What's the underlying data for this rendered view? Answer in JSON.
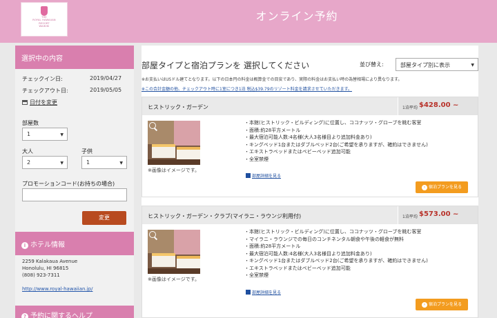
{
  "header": {
    "title": "オンライン予約",
    "logo": {
      "line1": "THE",
      "line2": "ROYAL HAWAIIAN",
      "line3": "RESORT",
      "line4": "WAIKIKI"
    }
  },
  "sidebar": {
    "selection_title": "選択中の内容",
    "checkin_label": "チェックイン日:",
    "checkin_value": "2019/04/27",
    "checkout_label": "チェックアウト日:",
    "checkout_value": "2019/05/05",
    "date_change": "日付を変更",
    "rooms_label": "部屋数",
    "rooms_value": "1",
    "adults_label": "大人",
    "adults_value": "2",
    "children_label": "子供",
    "children_value": "1",
    "promo_label": "プロモーションコード(お持ちの場合)",
    "promo_value": "",
    "change_button": "変更",
    "hotel_info_title": "ホテル情報",
    "address_line1": "2259 Kalakaua Avenue",
    "address_line2": "Honolulu, HI 96815",
    "phone": "(808) 923-7311",
    "website": "http://www.royal-hawaiian.jp/",
    "help_title": "予約に関するヘルプ"
  },
  "main": {
    "title": "部屋タイプと宿泊プランを 選択してください",
    "sort_label": "並び替え:",
    "sort_value": "部屋タイプ別に表示",
    "note1": "※お支払いはUSドル建てとなります。以下の日本円の料金は概算金での目安であり、実際の料金はお支払い時の為替相場により異なります。",
    "note2": "※この合計金額の他、チェックアウト時に1室につき1泊 税込$39.79のリゾート料金を請求させていただきます。"
  },
  "rooms": [
    {
      "name": "ヒストリック・ガーデン",
      "price_label": "1泊平均",
      "price": "$428.00 ~",
      "image_note": "※画像はイメージです。",
      "features": [
        "・本館(ヒストリック・ビルディング)に位置し、ココナッツ・グローブを眺む客室",
        "・面積:約28平方メートル",
        "・最大宿泊可能人数:4名様(大人3名様目より追加料金あり)",
        "・キングベッド1台またはダブルベッド2台(ご希望を承りますが、確約はできません)",
        "・エキストラベッドまたはベビーベッド追加可能",
        "・全室禁煙"
      ],
      "detail_link": "部屋詳細を見る",
      "plan_button": "宿泊プランを見る"
    },
    {
      "name": "ヒストリック・ガーデン・クラブ(マイラニ・ラウンジ利用付)",
      "price_label": "1泊平均",
      "price": "$573.00 ~",
      "image_note": "※画像はイメージです。",
      "features": [
        "・本館(ヒストリック・ビルディング)に位置し、ココナッツ・グローブを眺む客室",
        "・マイラニ・ラウンジでの毎日のコンチネンタル朝食や午後の軽食が無料",
        "・面積:約28平方メートル",
        "・最大宿泊可能人数:4名様(大人3名様目より追加料金あり)",
        "・キングベッド1台またはダブルベッド2台(ご希望を承りますが、確約はできません)",
        "・エキストラベッドまたはベビーベッド追加可能",
        "・全室禁煙"
      ],
      "detail_link": "部屋詳細を見る",
      "plan_button": "宿泊プランを見る"
    }
  ]
}
